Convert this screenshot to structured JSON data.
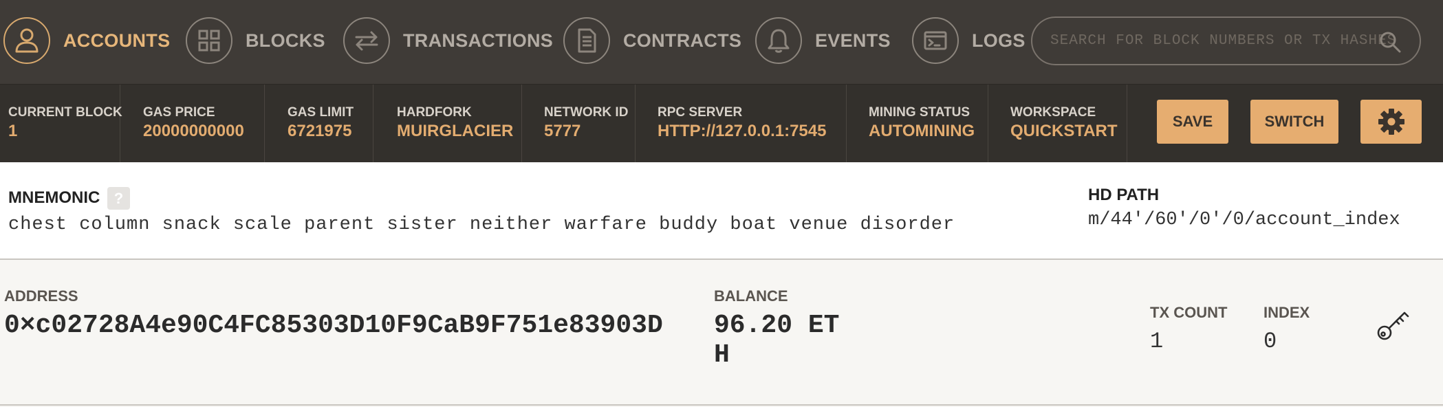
{
  "nav": {
    "items": [
      {
        "label": "ACCOUNTS",
        "icon": "user-icon",
        "active": true
      },
      {
        "label": "BLOCKS",
        "icon": "blocks-icon",
        "active": false
      },
      {
        "label": "TRANSACTIONS",
        "icon": "transfer-icon",
        "active": false
      },
      {
        "label": "CONTRACTS",
        "icon": "document-icon",
        "active": false
      },
      {
        "label": "EVENTS",
        "icon": "bell-icon",
        "active": false
      },
      {
        "label": "LOGS",
        "icon": "terminal-icon",
        "active": false
      }
    ],
    "search_placeholder": "SEARCH FOR BLOCK NUMBERS OR TX HASHES",
    "search_icon": "search-icon"
  },
  "status": {
    "current_block": {
      "label": "CURRENT BLOCK",
      "value": "1"
    },
    "gas_price": {
      "label": "GAS PRICE",
      "value": "20000000000"
    },
    "gas_limit": {
      "label": "GAS LIMIT",
      "value": "6721975"
    },
    "hardfork": {
      "label": "HARDFORK",
      "value": "MUIRGLACIER"
    },
    "network_id": {
      "label": "NETWORK ID",
      "value": "5777"
    },
    "rpc_server": {
      "label": "RPC SERVER",
      "value": "HTTP://127.0.0.1:7545"
    },
    "mining_status": {
      "label": "MINING STATUS",
      "value": "AUTOMINING"
    },
    "workspace": {
      "label": "WORKSPACE",
      "value": "QUICKSTART"
    },
    "save_label": "SAVE",
    "switch_label": "SWITCH",
    "settings_icon": "gear-icon"
  },
  "mnemonic": {
    "label": "MNEMONIC",
    "help": "?",
    "words": "chest column snack scale parent sister neither warfare buddy boat venue disorder",
    "hd_path_label": "HD PATH",
    "hd_path": "m/44'/60'/0'/0/account_index"
  },
  "account": {
    "address_label": "ADDRESS",
    "address": "0×c02728A4e90C4FC85303D10F9CaB9F751e83903D",
    "balance_label": "BALANCE",
    "balance": "96.20 ETH",
    "tx_count_label": "TX COUNT",
    "tx_count": "1",
    "index_label": "INDEX",
    "index": "0",
    "key_icon": "key-icon"
  },
  "colors": {
    "accent": "#e6ad70",
    "nav_bg": "#3f3b37",
    "status_bg": "#33302c"
  }
}
